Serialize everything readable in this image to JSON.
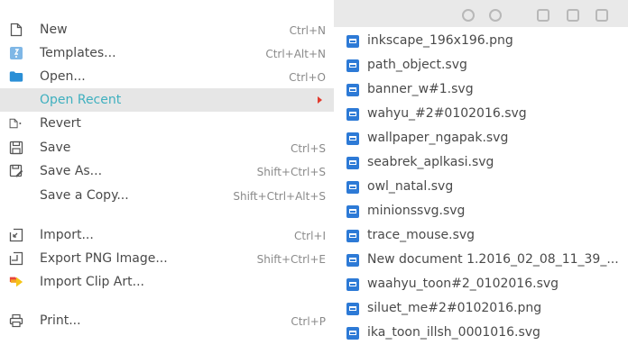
{
  "colors": {
    "accent": "#3fb0bf",
    "highlight_bg": "#e6e6e6",
    "arrow": "#e23b2e",
    "file_icon": "#2d7ad6"
  },
  "file_menu": {
    "items": [
      {
        "label": "New",
        "shortcut": "Ctrl+N",
        "icon": "new-document-icon"
      },
      {
        "label": "Templates...",
        "shortcut": "Ctrl+Alt+N",
        "icon": "templates-icon"
      },
      {
        "label": "Open...",
        "shortcut": "Ctrl+O",
        "icon": "open-folder-icon"
      },
      {
        "label": "Open Recent",
        "shortcut": "",
        "icon": ""
      },
      {
        "label": "Revert",
        "shortcut": "",
        "icon": "revert-icon"
      },
      {
        "label": "Save",
        "shortcut": "Ctrl+S",
        "icon": "save-icon"
      },
      {
        "label": "Save As...",
        "shortcut": "Shift+Ctrl+S",
        "icon": "save-as-icon"
      },
      {
        "label": "Save a Copy...",
        "shortcut": "Shift+Ctrl+Alt+S",
        "icon": ""
      },
      {
        "label": "Import...",
        "shortcut": "Ctrl+I",
        "icon": "import-icon"
      },
      {
        "label": "Export PNG Image...",
        "shortcut": "Shift+Ctrl+E",
        "icon": "export-png-icon"
      },
      {
        "label": "Import Clip Art...",
        "shortcut": "",
        "icon": "clip-art-icon"
      },
      {
        "label": "Print...",
        "shortcut": "Ctrl+P",
        "icon": "print-icon"
      }
    ]
  },
  "recent_files": [
    "inkscape_196x196.png",
    "path_object.svg",
    "banner_w#1.svg",
    "wahyu_#2#0102016.svg",
    "wallpaper_ngapak.svg",
    "seabrek_aplkasi.svg",
    "owl_natal.svg",
    "minionssvg.svg",
    "trace_mouse.svg",
    "New document 1.2016_02_08_11_39_...",
    "waahyu_toon#2_0102016.svg",
    "siluet_me#2#0102016.png",
    "ika_toon_illsh_0001016.svg"
  ]
}
